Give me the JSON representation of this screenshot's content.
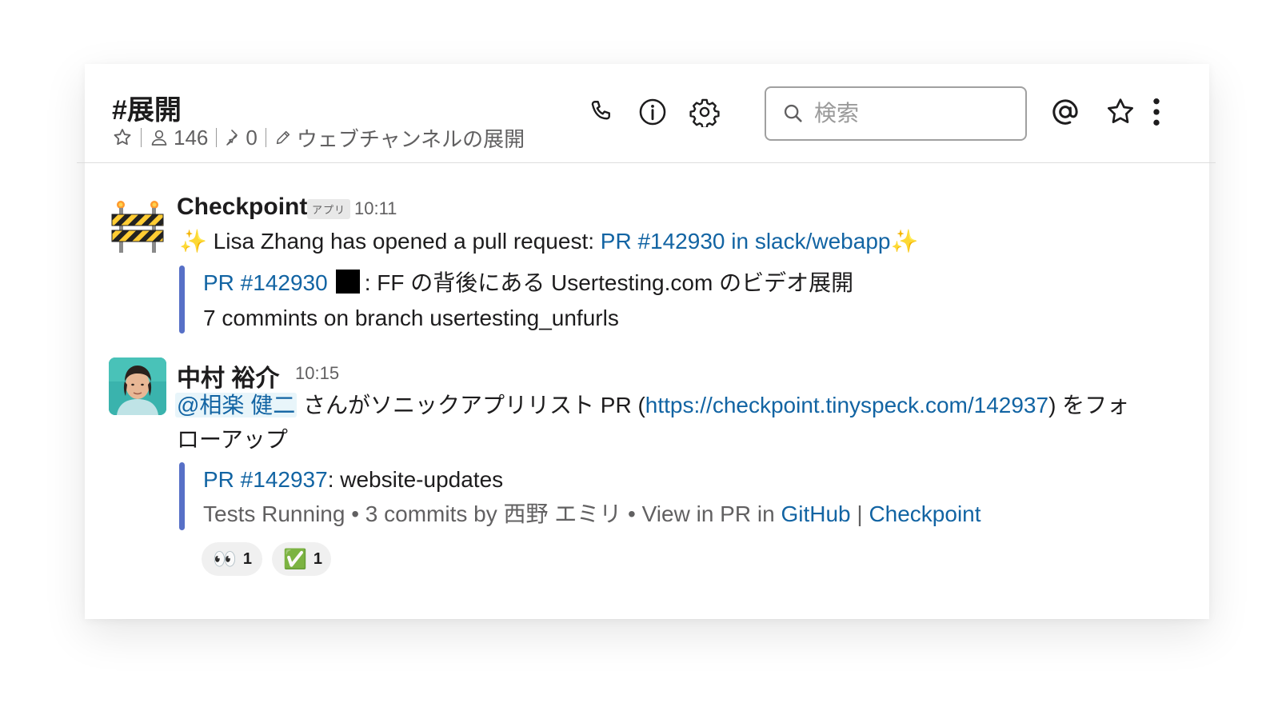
{
  "channel": {
    "title": "#展開",
    "members": "146",
    "pins": "0",
    "topic": "ウェブチャンネルの展開"
  },
  "search": {
    "placeholder": "検索"
  },
  "icons": [
    "phone-icon",
    "info-icon",
    "gear-icon",
    "search-icon",
    "at-icon",
    "star-icon",
    "more-icon"
  ],
  "messages": [
    {
      "sender": "Checkpoint",
      "app_badge": "アプリ",
      "time": "10:11",
      "sparkle": "✨",
      "text_pre": "Lisa Zhang has opened a pull request: ",
      "link": "PR #142930 in slack/webapp",
      "attachment": {
        "pr_link": "PR #142930",
        "title_rest": ": FF の背後にある Usertesting.com のビデオ展開",
        "subtitle": "7 commints on branch usertesting_unfurls"
      }
    },
    {
      "sender": "中村 裕介",
      "time": "10:15",
      "mention": "@相楽 健二",
      "text_a": " さんがソニックアプリリスト PR (",
      "url": "https://checkpoint.tinyspeck.com/142937",
      "text_b": ") をフォ",
      "text_c": "ローアップ",
      "attachment": {
        "pr_link": "PR #142937",
        "title_rest": ": website-updates",
        "meta_text": "Tests Running • 3 commits by 西野 エミリ • View in PR in ",
        "github": "GitHub",
        "sep": " | ",
        "checkpoint": "Checkpoint"
      },
      "reactions": [
        {
          "emoji": "👀",
          "count": "1"
        },
        {
          "emoji": "✅",
          "count": "1"
        }
      ]
    }
  ]
}
